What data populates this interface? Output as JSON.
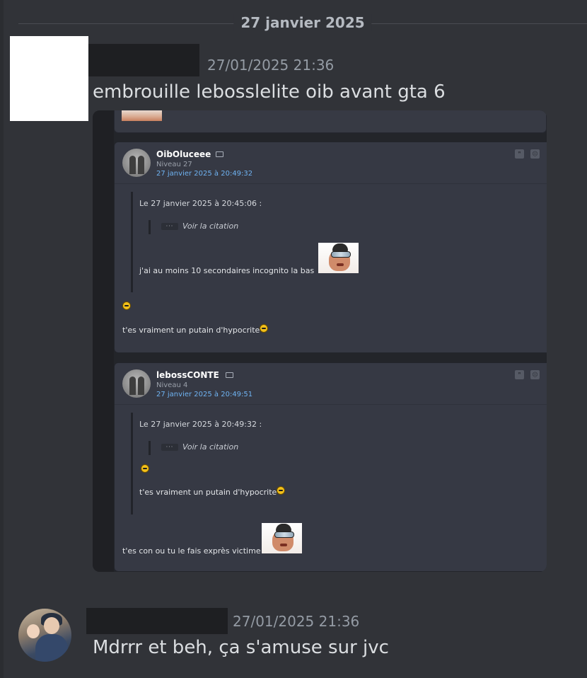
{
  "date_divider": "27 janvier 2025",
  "messages": [
    {
      "timestamp": "27/01/2025 21:36",
      "text": "embrouille lebosslelite oib avant gta 6"
    },
    {
      "timestamp": "27/01/2025 21:36",
      "text": "Mdrrr et beh, ça s'amuse sur jvc"
    }
  ],
  "attachment": {
    "posts": [
      {
        "author": "OibOluceee",
        "level": "Niveau 27",
        "date": "27 janvier 2025 à 20:49:32",
        "quote_header": "Le 27 janvier 2025 à 20:45:06 :",
        "quote_toggle": "Voir la citation",
        "quote_text": "j'ai au moins 10 secondaires incognito la bas",
        "reply_text": "t'es vraiment un putain d'hypocrite"
      },
      {
        "author": "lebossCONTE",
        "level": "Niveau 4",
        "date": "27 janvier 2025 à 20:49:51",
        "quote_header": "Le 27 janvier 2025 à 20:49:32 :",
        "quote_toggle": "Voir la citation",
        "quote_text": "t'es vraiment un putain d'hypocrite",
        "reply_text": "t'es con ou tu le fais exprès victime"
      }
    ]
  },
  "icons": {
    "mail": "mail-icon",
    "quote": "quote-icon",
    "report": "report-icon",
    "smiley": "laughing-smiley-icon"
  },
  "colors": {
    "background": "#313338",
    "post_date_link": "#6fb3f2",
    "timestamp": "#949ba4"
  }
}
